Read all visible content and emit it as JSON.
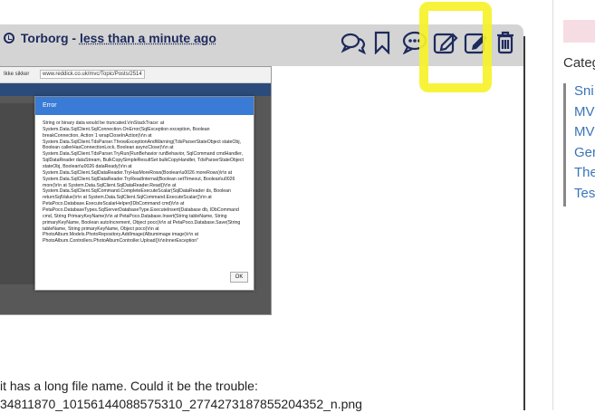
{
  "post": {
    "author": "Torborg",
    "separator": "-",
    "time": "less than a minute ago",
    "actions": [
      {
        "name": "reply-icon",
        "label": "Reply"
      },
      {
        "name": "bookmark-icon",
        "label": "Bookmark"
      },
      {
        "name": "comment-icon",
        "label": "Comment"
      },
      {
        "name": "edit-icon",
        "label": "Edit"
      },
      {
        "name": "edit-alt-icon",
        "label": "Edit"
      },
      {
        "name": "delete-icon",
        "label": "Delete"
      }
    ],
    "text_line1": "it has a long file name. Could it be the trouble:",
    "text_line2": "34811870_10156144088575310_2774273187855204352_n.png"
  },
  "screenshot": {
    "tab": "Ikke sikker",
    "url": "www.reddick.co.uk/mvc/Topic/Posts/2514",
    "modal_title": "Error",
    "modal_body": "String or binary data would be truncated.\\r\\nStackTrace: at System.Data.SqlClient.SqlConnection.OnError(SqlException exception, Boolean breakConnection, Action`1 wrapCloseInAction)\\r\\n at System.Data.SqlClient.TdsParser.ThrowExceptionAndWarning(TdsParserStateObject stateObj, Boolean callerHasConnectionLock, Boolean asyncClose)\\r\\n at System.Data.SqlClient.TdsParser.TryRun(RunBehavior runBehavior, SqlCommand cmdHandler, SqlDataReader dataStream, BulkCopySimpleResultSet bulkCopyHandler, TdsParserStateObject stateObj, Boolean\\u0026 dataReady)\\r\\n at System.Data.SqlClient.SqlDataReader.TryHasMoreRows(Boolean\\u0026 moreRows)\\r\\n at System.Data.SqlClient.SqlDataReader.TryReadInternal(Boolean setTimeout, Boolean\\u0026 more)\\r\\n at System.Data.SqlClient.SqlDataReader.Read()\\r\\n at System.Data.SqlClient.SqlCommand.CompleteExecuteScalar(SqlDataReader ds, Boolean returnSqlValue)\\r\\n at System.Data.SqlClient.SqlCommand.ExecuteScalar()\\r\\n at PetaPoco.Database.ExecuteScalarHelper(IDbCommand cmd)\\r\\n at PetaPoco.DatabaseTypes.SqlServerDatabaseType.ExecuteInsert(Database db, IDbCommand cmd, String PrimaryKeyName)\\r\\n at PetaPoco.Database.Insert(String tableName, String primaryKeyName, Boolean autoIncrement, Object poco)\\r\\n at PetaPoco.Database.Save(String tableName, String primaryKeyName, Object poco)\\r\\n at PhotoAlbum.Models.PhotoRepository.AddImage(Albumimage image)\\r\\n at PhotoAlbum.Controllers.PhotoAlbumController.Upload()\\r\\nInnerException\"",
    "ok_label": "OK"
  },
  "sidebar": {
    "title": "Categ",
    "items": [
      "Sni",
      "MV",
      "MV",
      "Ger",
      "The",
      "Tes"
    ]
  },
  "colors": {
    "header_bg": "#d4d4d4",
    "icon_color": "#1d2a5c",
    "highlight": "#f6f22a",
    "link": "#3b74b8",
    "modal_header": "#3a7bd5"
  }
}
